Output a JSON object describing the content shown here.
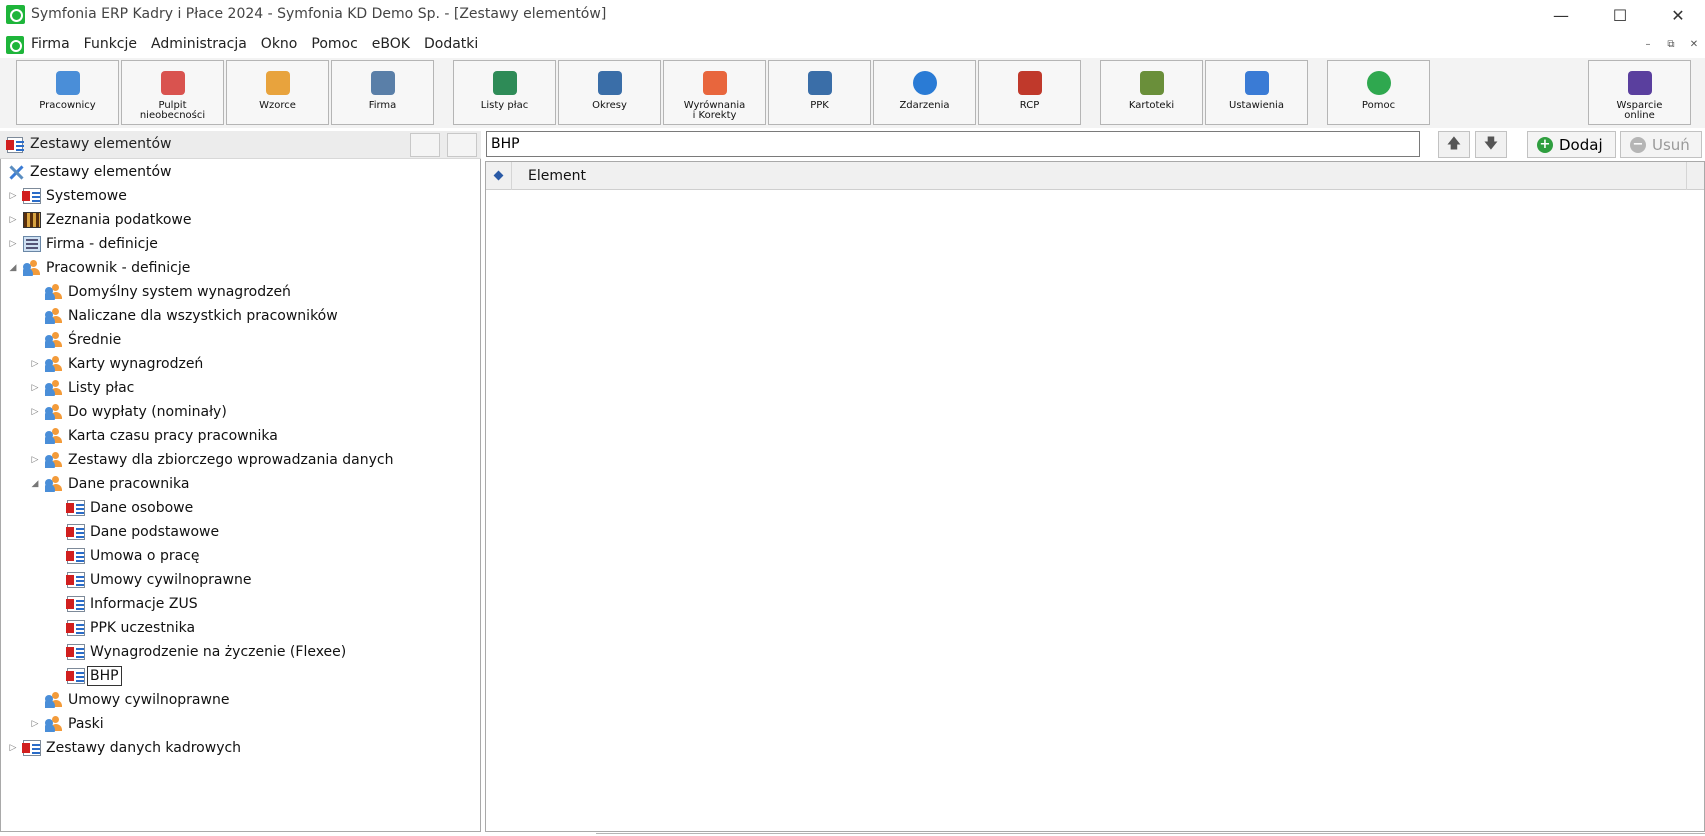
{
  "window": {
    "title": "Symfonia ERP Kadry i Płace 2024 - Symfonia KD Demo Sp. - [Zestawy elementów]",
    "minimize": "—",
    "maximize": "☐",
    "close": "✕"
  },
  "menu": {
    "items": [
      "Firma",
      "Funkcje",
      "Administracja",
      "Okno",
      "Pomoc",
      "eBOK",
      "Dodatki"
    ],
    "mdi_min": "–",
    "mdi_restore": "⧉",
    "mdi_close": "✕"
  },
  "toolbar": {
    "buttons": [
      {
        "label": "Pracownicy",
        "icon": "employees-icon"
      },
      {
        "label": "Pulpit\nnieobecności",
        "icon": "absence-desktop-icon"
      },
      {
        "label": "Wzorce",
        "icon": "templates-icon"
      },
      {
        "label": "Firma",
        "icon": "company-icon"
      },
      {
        "label": "Listy płac",
        "icon": "payroll-icon"
      },
      {
        "label": "Okresy",
        "icon": "periods-icon"
      },
      {
        "label": "Wyrównania\ni Korekty",
        "icon": "corrections-icon"
      },
      {
        "label": "PPK",
        "icon": "ppk-icon"
      },
      {
        "label": "Zdarzenia",
        "icon": "events-icon"
      },
      {
        "label": "RCP",
        "icon": "rcp-icon"
      },
      {
        "label": "Kartoteki",
        "icon": "records-icon"
      },
      {
        "label": "Ustawienia",
        "icon": "settings-icon"
      },
      {
        "label": "Pomoc",
        "icon": "help-icon"
      },
      {
        "label": "Wsparcie\nonline",
        "icon": "online-support-icon"
      }
    ]
  },
  "left_panel": {
    "title": "Zestawy elementów"
  },
  "tree": {
    "root": "Zestawy elementów",
    "nodes": [
      {
        "label": "Systemowe",
        "expander": "▷"
      },
      {
        "label": "Zeznania podatkowe",
        "expander": "▷"
      },
      {
        "label": "Firma - definicje",
        "expander": "▷"
      },
      {
        "label": "Pracownik - definicje",
        "expander": "◢"
      },
      {
        "label": "Domyślny system wynagrodzeń",
        "expander": ""
      },
      {
        "label": "Naliczane dla wszystkich pracowników",
        "expander": ""
      },
      {
        "label": "Średnie",
        "expander": ""
      },
      {
        "label": "Karty wynagrodzeń",
        "expander": "▷"
      },
      {
        "label": "Listy płac",
        "expander": "▷"
      },
      {
        "label": "Do wypłaty (nominały)",
        "expander": "▷"
      },
      {
        "label": "Karta czasu pracy pracownika",
        "expander": ""
      },
      {
        "label": "Zestawy dla zbiorczego wprowadzania danych",
        "expander": "▷"
      },
      {
        "label": "Dane pracownika",
        "expander": "◢"
      },
      {
        "label": "Dane osobowe",
        "expander": ""
      },
      {
        "label": "Dane podstawowe",
        "expander": ""
      },
      {
        "label": "Umowa o pracę",
        "expander": ""
      },
      {
        "label": "Umowy cywilnoprawne",
        "expander": ""
      },
      {
        "label": "Informacje ZUS",
        "expander": ""
      },
      {
        "label": "PPK uczestnika",
        "expander": ""
      },
      {
        "label": "Wynagrodzenie na życzenie (Flexee)",
        "expander": ""
      },
      {
        "label": "BHP",
        "expander": ""
      },
      {
        "label": "Umowy cywilnoprawne",
        "expander": ""
      },
      {
        "label": "Paski",
        "expander": "▷"
      },
      {
        "label": "Zestawy danych kadrowych",
        "expander": "▷"
      }
    ]
  },
  "search": {
    "value": "BHP"
  },
  "actions": {
    "up": "🡅",
    "down": "🡇",
    "add_label": "Dodaj",
    "add_symbol": "+",
    "remove_label": "Usuń",
    "remove_symbol": "−"
  },
  "grid": {
    "column": "Element"
  },
  "colors": {
    "add": "#2f9e3f",
    "remove_disabled": "#b5b5b5"
  }
}
